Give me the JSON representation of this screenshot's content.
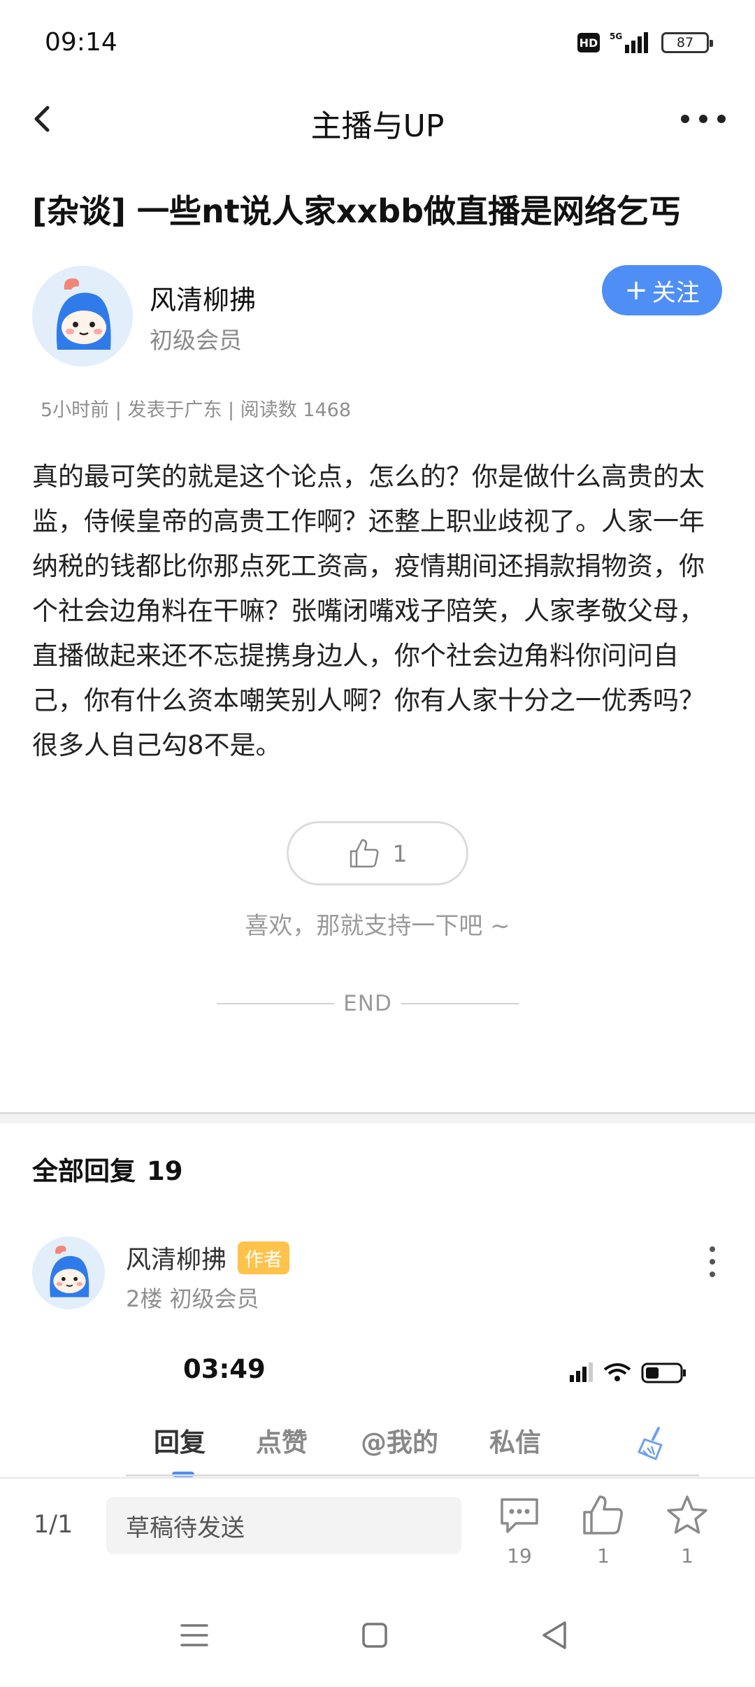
{
  "status_bar": {
    "time": "09:14",
    "network": "5G",
    "battery": "87"
  },
  "header": {
    "title": "主播与UP"
  },
  "post": {
    "title": "[杂谈] 一些nt说人家xxbb做直播是网络乞丐",
    "author": {
      "name": "风清柳拂",
      "level": "初级会员"
    },
    "follow_label": "关注",
    "meta": "5小时前 | 发表于广东 | 阅读数 1468",
    "body": "真的最可笑的就是这个论点，怎么的？你是做什么高贵的太监，侍候皇帝的高贵工作啊？还整上职业歧视了。人家一年纳税的钱都比你那点死工资高，疫情期间还捐款捐物资，你个社会边角料在干嘛？张嘴闭嘴戏子陪笑，人家孝敬父母，直播做起来还不忘提携身边人，你个社会边角料你问问自己，你有什么资本嘲笑别人啊？你有人家十分之一优秀吗？很多人自己勾8不是。",
    "like_count": "1",
    "support_text": "喜欢，那就支持一下吧 ~",
    "end_text": "END"
  },
  "replies": {
    "title": "全部回复",
    "count": "19",
    "items": [
      {
        "name": "风清柳拂",
        "badge": "作者",
        "meta": "2楼 初级会员",
        "embedded_screenshot": {
          "time": "03:49",
          "tabs": [
            "回复",
            "点赞",
            "@我的",
            "私信"
          ]
        }
      }
    ]
  },
  "bottom_bar": {
    "page_indicator": "1/1",
    "draft_placeholder": "草稿待发送",
    "comments_count": "19",
    "likes_count": "1",
    "favorites_count": "1"
  },
  "icons": {
    "back": "chevron-left-icon",
    "more": "more-horizontal-icon",
    "like": "thumbs-up-icon",
    "comment": "comment-icon",
    "star": "star-icon",
    "accent_color": "#4f8ff5",
    "badge_color": "#ffc24a"
  }
}
